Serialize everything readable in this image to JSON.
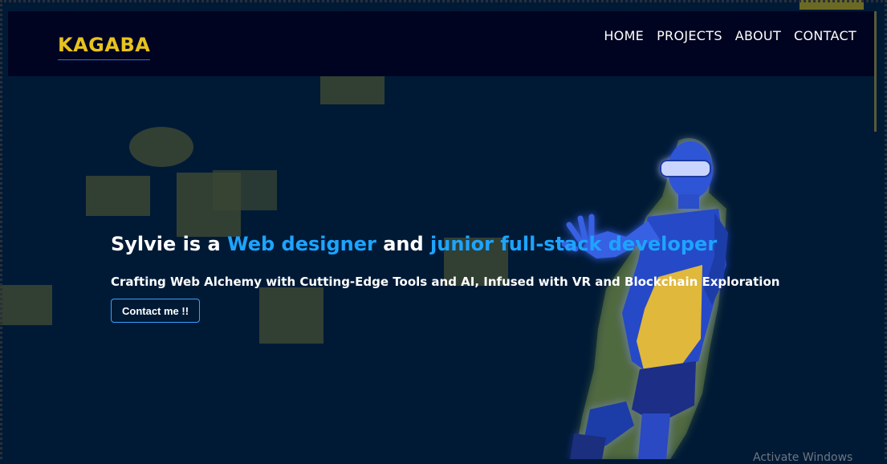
{
  "header": {
    "logo": "KAGABA",
    "nav": [
      {
        "label": "HOME"
      },
      {
        "label": "PROJECTS"
      },
      {
        "label": "ABOUT"
      },
      {
        "label": "CONTACT"
      }
    ]
  },
  "hero": {
    "title_prefix": "Sylvie is a ",
    "title_role1": "Web designer",
    "title_and": " and ",
    "title_role2": "junior full-stack developer",
    "subtitle": "Crafting Web Alchemy with Cutting-Edge Tools and AI, Infused with VR and Blockchain Exploration",
    "cta_label": "Contact me !!"
  },
  "overlay": {
    "activate_windows": "Activate Windows"
  },
  "colors": {
    "background": "#001a36",
    "header_bg": "#010420",
    "logo": "#e7c31d",
    "accent": "#1da4ff",
    "shapes": "#3b4733"
  }
}
